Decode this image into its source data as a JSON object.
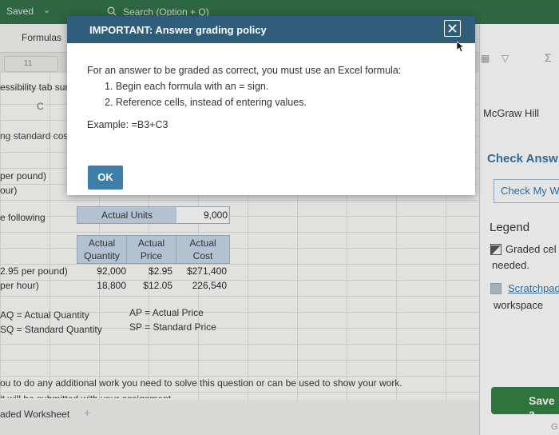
{
  "topbar": {
    "saved_label": "Saved",
    "search_placeholder": "Search (Option + Q)"
  },
  "ribbon": {
    "formulas_tab": "Formulas",
    "font_size": "11",
    "sigma_icon": "Σ"
  },
  "sheet": {
    "accessibility_text": "essibility tab sur",
    "column_c_label": "C",
    "standard_cost_text": "ng standard cost",
    "per_pound_text": "per pound)",
    "hour_text": "our)",
    "following_text": "e following",
    "actual_units_label": "Actual Units",
    "actual_units_value": "9,000",
    "headers": [
      "Actual\nQuantity",
      "Actual\nPrice",
      "Actual\nCost"
    ],
    "rows": [
      {
        "label": "2.95 per pound)",
        "quantity": "92,000",
        "price": "$2.95",
        "cost": "$271,400"
      },
      {
        "label": "per hour)",
        "quantity": "18,800",
        "price": "$12.05",
        "cost": "226,540"
      }
    ],
    "aq_note": "AQ = Actual Quantity",
    "sq_note": "SQ = Standard Quantity",
    "ap_note": "AP = Actual Price",
    "sp_note": "SP = Standard Price",
    "work_note": "ou to do any additional work you need to solve this question or can be used to show your work.",
    "submitted_note": "it will be submitted with your assignment",
    "sheet_tab": "aded Worksheet",
    "add_tab": "+"
  },
  "right_panel": {
    "brand": "McGraw Hill",
    "check_answer": "Check Answ",
    "check_my_work": "Check My W",
    "legend_title": "Legend",
    "graded_label": "Graded cel",
    "needed_label": "needed.",
    "scratchpad_label": "Scratchpad",
    "workspace_label": "workspace",
    "save_label": "Save a",
    "g_letter": "G"
  },
  "modal": {
    "title": "IMPORTANT: Answer grading policy",
    "instruction": "For an answer to be graded as correct, you must use an Excel formula:",
    "steps": [
      "1. Begin each formula with an = sign.",
      "2. Reference cells, instead of entering values."
    ],
    "example": "Example: =B3+C3",
    "ok_label": "OK"
  },
  "colors": {
    "header_bg": "#2f5d7a",
    "ok_button": "#3f7ea9",
    "save_button": "#2f7f3f",
    "table_header": "#c5d8e7",
    "topbar": "#2f6f45"
  }
}
